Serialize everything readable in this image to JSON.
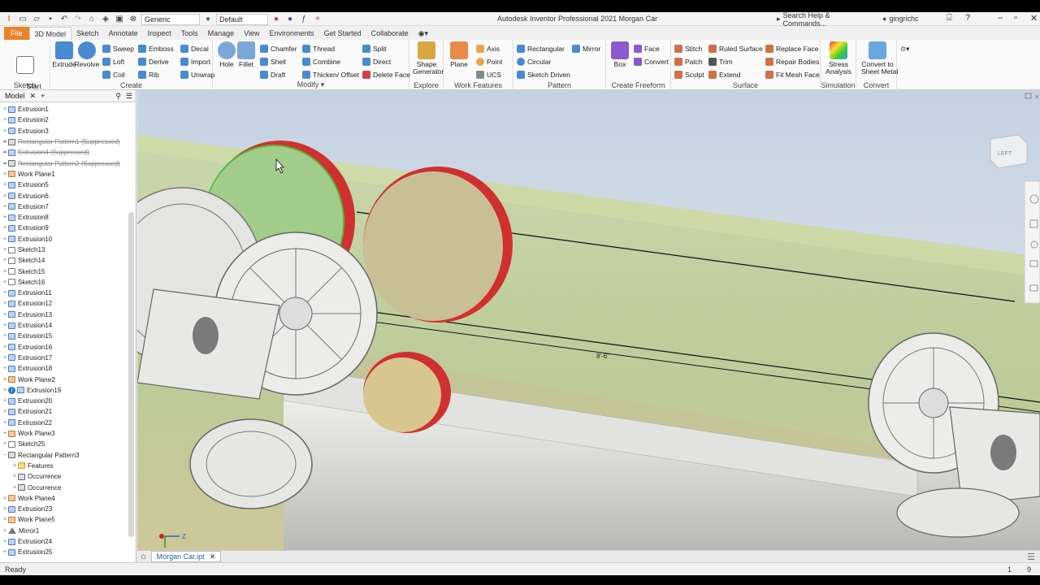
{
  "titlebar": {
    "appearance_select": "Generic",
    "material_select": "Default",
    "title": "Autodesk Inventor Professional 2021   Morgan Car",
    "search_placeholder": "Search Help & Commands...",
    "user": "gingrichc"
  },
  "tabs": [
    {
      "label": "File"
    },
    {
      "label": "3D Model"
    },
    {
      "label": "Sketch"
    },
    {
      "label": "Annotate"
    },
    {
      "label": "Inspect"
    },
    {
      "label": "Tools"
    },
    {
      "label": "Manage"
    },
    {
      "label": "View"
    },
    {
      "label": "Environments"
    },
    {
      "label": "Get Started"
    },
    {
      "label": "Collaborate"
    }
  ],
  "ribbon": {
    "sketch": {
      "label": "Sketch",
      "start": "Start\n2D Sketch"
    },
    "create": {
      "label": "Create",
      "extrude": "Extrude",
      "revolve": "Revolve",
      "sweep": "Sweep",
      "loft": "Loft",
      "coil": "Coil",
      "emboss": "Emboss",
      "derive": "Derive",
      "rib": "Rib",
      "decal": "Decal",
      "import": "Import",
      "unwrap": "Unwrap"
    },
    "modify": {
      "label": "Modify",
      "hole": "Hole",
      "fillet": "Fillet",
      "chamfer": "Chamfer",
      "shell": "Shell",
      "draft": "Draft",
      "thread": "Thread",
      "combine": "Combine",
      "thicken": "Thicken/ Offset",
      "split": "Split",
      "direct": "Direct",
      "delete_face": "Delete Face"
    },
    "explore": {
      "label": "Explore",
      "shape": "Shape\nGenerator"
    },
    "work": {
      "label": "Work Features",
      "plane": "Plane",
      "axis": "Axis",
      "point": "Point",
      "ucs": "UCS"
    },
    "pattern": {
      "label": "Pattern",
      "rectangular": "Rectangular",
      "circular": "Circular",
      "sketch_driven": "Sketch Driven",
      "mirror": "Mirror"
    },
    "freeform": {
      "label": "Create Freeform",
      "box": "Box",
      "face": "Face",
      "convert": "Convert"
    },
    "surface": {
      "label": "Surface",
      "stitch": "Stitch",
      "patch": "Patch",
      "sculpt": "Sculpt",
      "ruled": "Ruled Surface",
      "trim": "Trim",
      "extend": "Extend",
      "replace": "Replace Face",
      "repair": "Repair Bodies",
      "fit_mesh": "Fit Mesh Face"
    },
    "simulation": {
      "label": "Simulation",
      "stress": "Stress\nAnalysis"
    },
    "convert": {
      "label": "Convert",
      "sheet": "Convert to\nSheet Metal"
    }
  },
  "browser": {
    "title": "Model",
    "nodes": [
      {
        "label": "Extrusion1",
        "icon": "extrusion",
        "suppressed": false
      },
      {
        "label": "Extrusion2",
        "icon": "extrusion",
        "suppressed": false
      },
      {
        "label": "Extrusion3",
        "icon": "extrusion",
        "suppressed": false
      },
      {
        "label": "Rectangular Pattern1 (Suppressed)",
        "icon": "pattern",
        "suppressed": true
      },
      {
        "label": "Extrusion4 (Suppressed)",
        "icon": "extrusion",
        "suppressed": true
      },
      {
        "label": "Rectangular Pattern2 (Suppressed)",
        "icon": "pattern",
        "suppressed": true
      },
      {
        "label": "Work Plane1",
        "icon": "plane",
        "suppressed": false
      },
      {
        "label": "Extrusion5",
        "icon": "extrusion",
        "suppressed": false
      },
      {
        "label": "Extrusion6",
        "icon": "extrusion",
        "suppressed": false
      },
      {
        "label": "Extrusion7",
        "icon": "extrusion",
        "suppressed": false
      },
      {
        "label": "Extrusion8",
        "icon": "extrusion",
        "suppressed": false
      },
      {
        "label": "Extrusion9",
        "icon": "extrusion",
        "suppressed": false
      },
      {
        "label": "Extrusion10",
        "icon": "extrusion",
        "suppressed": false
      },
      {
        "label": "Sketch13",
        "icon": "sketch",
        "suppressed": false
      },
      {
        "label": "Sketch14",
        "icon": "sketch",
        "suppressed": false
      },
      {
        "label": "Sketch15",
        "icon": "sketch",
        "suppressed": false
      },
      {
        "label": "Sketch16",
        "icon": "sketch",
        "suppressed": false
      },
      {
        "label": "Extrusion11",
        "icon": "extrusion",
        "suppressed": false
      },
      {
        "label": "Extrusion12",
        "icon": "extrusion",
        "suppressed": false
      },
      {
        "label": "Extrusion13",
        "icon": "extrusion",
        "suppressed": false
      },
      {
        "label": "Extrusion14",
        "icon": "extrusion",
        "suppressed": false
      },
      {
        "label": "Extrusion15",
        "icon": "extrusion",
        "suppressed": false
      },
      {
        "label": "Extrusion16",
        "icon": "extrusion",
        "suppressed": false
      },
      {
        "label": "Extrusion17",
        "icon": "extrusion",
        "suppressed": false
      },
      {
        "label": "Extrusion18",
        "icon": "extrusion",
        "suppressed": false
      },
      {
        "label": "Work Plane2",
        "icon": "plane",
        "suppressed": false
      },
      {
        "label": "Extrusion19",
        "icon": "extrusion",
        "suppressed": false,
        "info": true
      },
      {
        "label": "Extrusion20",
        "icon": "extrusion",
        "suppressed": false
      },
      {
        "label": "Extrusion21",
        "icon": "extrusion",
        "suppressed": false
      },
      {
        "label": "Extrusion22",
        "icon": "extrusion",
        "suppressed": false
      },
      {
        "label": "Work Plane3",
        "icon": "plane",
        "suppressed": false
      },
      {
        "label": "Sketch25",
        "icon": "sketch",
        "suppressed": false
      },
      {
        "label": "Rectangular Pattern3",
        "icon": "pattern",
        "suppressed": false,
        "expanded": true
      },
      {
        "label": "Features",
        "icon": "folder",
        "suppressed": false,
        "indent": 1
      },
      {
        "label": "Occurrence",
        "icon": "pattern",
        "suppressed": false,
        "indent": 1
      },
      {
        "label": "Occurrence",
        "icon": "pattern",
        "suppressed": false,
        "indent": 1
      },
      {
        "label": "Work Plane4",
        "icon": "plane",
        "suppressed": false
      },
      {
        "label": "Extrusion23",
        "icon": "extrusion",
        "suppressed": false
      },
      {
        "label": "Work Plane5",
        "icon": "plane",
        "suppressed": false
      },
      {
        "label": "Mirror1",
        "icon": "mirror",
        "suppressed": false
      },
      {
        "label": "Extrusion24",
        "icon": "extrusion",
        "suppressed": false
      },
      {
        "label": "Extrusion25",
        "icon": "extrusion",
        "suppressed": false
      }
    ]
  },
  "viewport": {
    "viewcube_label": "LEFT",
    "dimension": "8'-6\""
  },
  "doctab": {
    "label": "Morgan Car.ipt"
  },
  "status": {
    "text": "Ready",
    "count1": "1",
    "count2": "9"
  }
}
